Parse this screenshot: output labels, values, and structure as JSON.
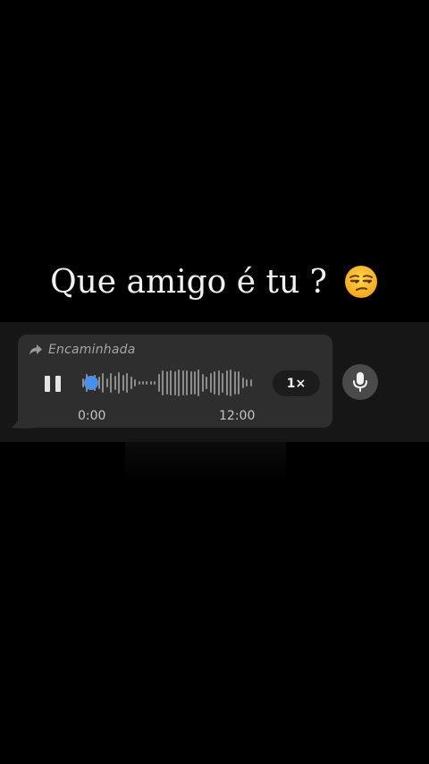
{
  "caption": {
    "text": "Que amigo é tu ?",
    "emoji_icon": "unamused-face-emoji"
  },
  "voice_message": {
    "forwarded_label": "Encaminhada",
    "forward_icon": "forward-arrow-icon",
    "playback_state": "playing",
    "play_pause_icon": "pause-icon",
    "progress_fraction": 0.0,
    "current_time": "0:00",
    "total_time": "12:00",
    "speed_label": "1×",
    "waveform_levels": [
      0.28,
      0.55,
      0.22,
      0.5,
      0.4,
      0.62,
      0.3,
      0.6,
      0.45,
      0.68,
      0.5,
      0.6,
      0.38,
      0.2,
      0.12,
      0.1,
      0.1,
      0.1,
      0.12,
      0.58,
      0.78,
      0.72,
      0.8,
      0.75,
      0.82,
      0.78,
      0.8,
      0.7,
      0.74,
      0.82,
      0.55,
      0.38,
      0.62,
      0.72,
      0.8,
      0.6,
      0.78,
      0.82,
      0.74,
      0.7,
      0.35,
      0.2,
      0.22
    ]
  },
  "composer": {
    "mic_icon": "microphone-icon"
  },
  "colors": {
    "background": "#000000",
    "bubble": "#2e2e2e",
    "accent": "#4a90e8",
    "waveform": "#8c8c8c"
  }
}
